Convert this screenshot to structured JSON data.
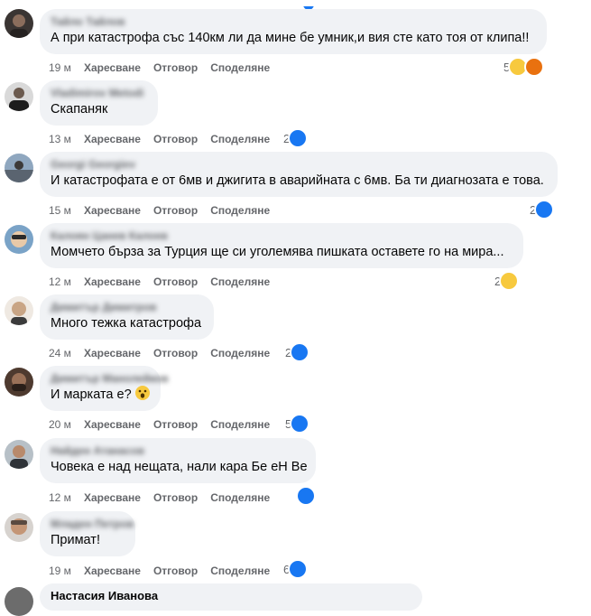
{
  "actions": {
    "like": "Харесване",
    "reply": "Отговор",
    "share": "Споделяне"
  },
  "comments": [
    {
      "author": "Тайло Тайлов",
      "text": "А при катастрофа със 140км ли да мине бе умник,и вия сте като тоя от клипа!!",
      "time": "19 м",
      "reaction_count": "5",
      "reactions": [
        "haha",
        "angry"
      ]
    },
    {
      "author": "Vladimirov Metodi",
      "text": "Скапаняк",
      "time": "13 м",
      "reaction_count": "2",
      "reactions": [
        "like"
      ]
    },
    {
      "author": "Georgi Georgiev",
      "text": "И катастрофата е от 6мв и джигита в аварийната с 6мв. Ба ти диагнозата е това.",
      "time": "15 м",
      "reaction_count": "2",
      "reactions": [
        "like"
      ]
    },
    {
      "author": "Калоян Цанев Калоев",
      "text": "Момчето бърза за Турция ще си уголемява пишката оставете го на мира...",
      "time": "12 м",
      "reaction_count": "2",
      "reactions": [
        "haha"
      ]
    },
    {
      "author": "Димитър Димитров",
      "text": "Много тежка катастрофа",
      "time": "24 м",
      "reaction_count": "2",
      "reactions": [
        "like"
      ]
    },
    {
      "author": "Димитър Манолейков",
      "text": "И марката е?",
      "time": "20 м",
      "reaction_count": "5",
      "reactions": [
        "like"
      ],
      "inline_emoji": "astonished-face"
    },
    {
      "author": "Найден Атанасов",
      "text": "Човека е над нещата, нали кара Бе еН Ве",
      "time": "12 м",
      "reaction_count": "",
      "reactions": [
        "like"
      ]
    },
    {
      "author": "Младен Петров",
      "text": "Примат!",
      "time": "19 м",
      "reaction_count": "6",
      "reactions": [
        "like"
      ]
    },
    {
      "author": "Настасия Иванова",
      "text": "",
      "time": "",
      "reaction_count": "",
      "reactions": []
    }
  ],
  "colors": {
    "bubble": "#f0f2f5",
    "meta_text": "#65676b",
    "like_blue": "#1877f2",
    "haha_yellow": "#f7c93e",
    "angry_orange": "#e9710f"
  }
}
